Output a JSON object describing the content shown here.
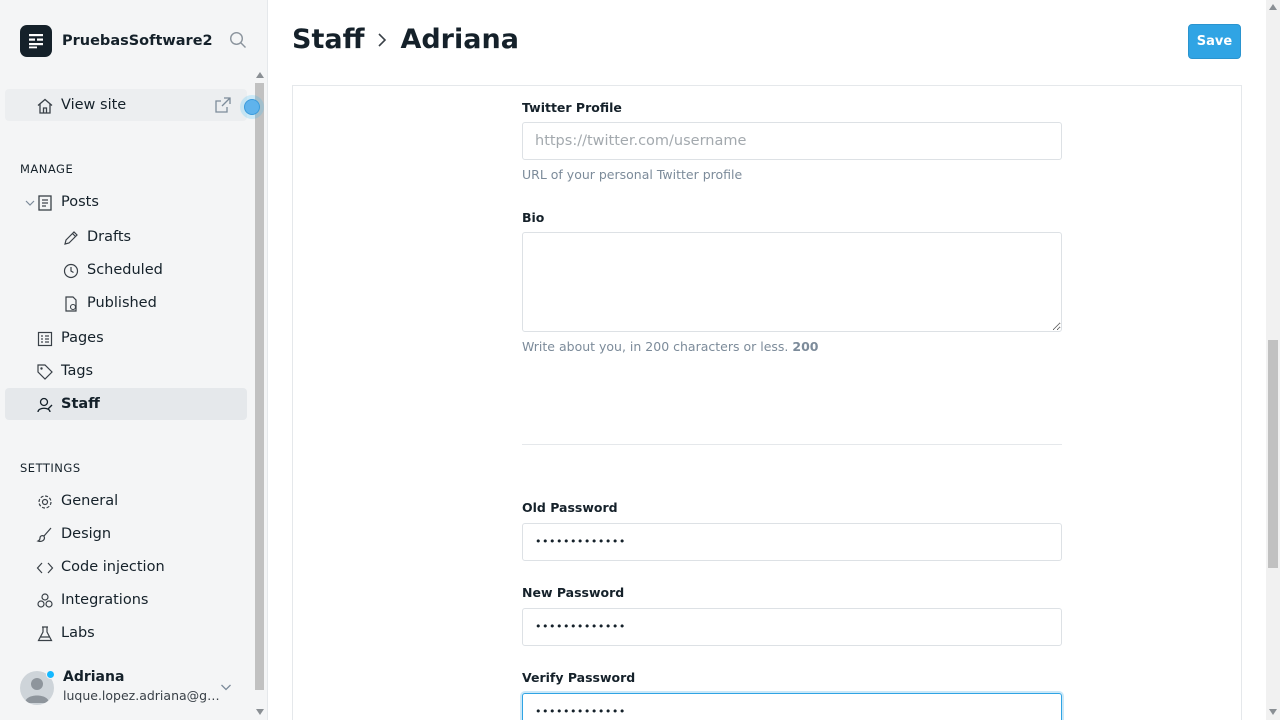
{
  "brand": {
    "name": "PruebasSoftware2"
  },
  "sidebar": {
    "view_site": "View site",
    "manage_heading": "MANAGE",
    "settings_heading": "SETTINGS",
    "posts": "Posts",
    "drafts": "Drafts",
    "scheduled": "Scheduled",
    "published": "Published",
    "pages": "Pages",
    "tags": "Tags",
    "staff": "Staff",
    "general": "General",
    "design": "Design",
    "code_injection": "Code injection",
    "integrations": "Integrations",
    "labs": "Labs"
  },
  "user": {
    "name": "Adriana",
    "email": "luque.lopez.adriana@gm..."
  },
  "header": {
    "section": "Staff",
    "current": "Adriana",
    "save_label": "Save"
  },
  "form": {
    "twitter": {
      "label": "Twitter Profile",
      "placeholder": "https://twitter.com/username",
      "help": "URL of your personal Twitter profile"
    },
    "bio": {
      "label": "Bio",
      "help": "Write about you, in 200 characters or less.",
      "count": "200"
    },
    "old_password": {
      "label": "Old Password",
      "value": "•••••••••••••"
    },
    "new_password": {
      "label": "New Password",
      "value": "•••••••••••••"
    },
    "verify_password": {
      "label": "Verify Password",
      "value": "•••••••••••••"
    }
  },
  "colors": {
    "accent": "#30a4e4",
    "text": "#15212a",
    "muted": "#7c8b9a"
  }
}
